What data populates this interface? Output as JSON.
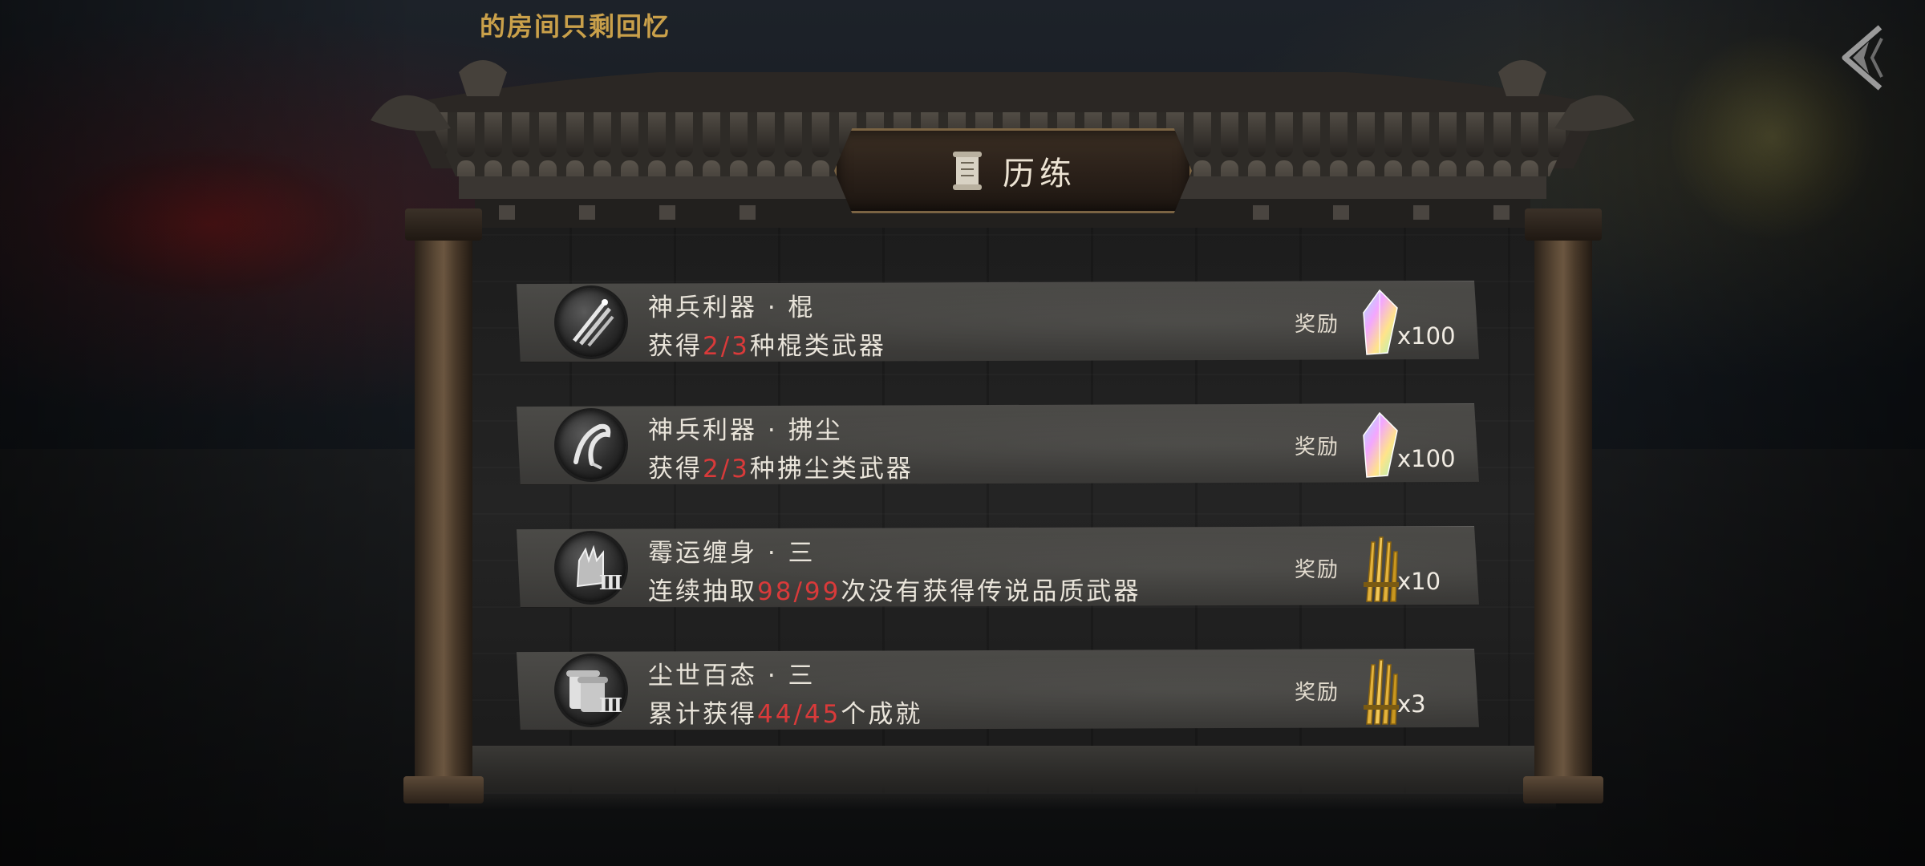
{
  "header": {
    "top_text": "‌\u0003的房间只剩回忆"
  },
  "panel": {
    "title": "历练",
    "title_icon": "scroll-icon"
  },
  "reward_label": "奖励",
  "rows": [
    {
      "name": "神兵利器 · 棍",
      "desc_pre": "获得",
      "desc_hl": "2/3",
      "desc_post": "种棍类武器",
      "icon": "staff-weapons-icon",
      "reward_icon": "crystal-icon",
      "reward_qty": "x100"
    },
    {
      "name": "神兵利器 · 拂尘",
      "desc_pre": "获得",
      "desc_hl": "2/3",
      "desc_post": "种拂尘类武器",
      "icon": "whisk-icon",
      "reward_icon": "crystal-icon",
      "reward_qty": "x100"
    },
    {
      "name": "霉运缠身 · 三",
      "desc_pre": "连续抽取",
      "desc_hl": "98/99",
      "desc_post": "次没有获得传说品质武器",
      "icon": "cursed-gauntlet-icon",
      "icon_roman": "Ⅲ",
      "reward_icon": "golden-incense-icon",
      "reward_qty": "x10"
    },
    {
      "name": "尘世百态 · 三",
      "desc_pre": "累计获得",
      "desc_hl": "44/45",
      "desc_post": "个成就",
      "icon": "scrolls-icon",
      "icon_roman": "Ⅲ",
      "reward_icon": "golden-incense-icon",
      "reward_qty": "x3"
    }
  ],
  "colors": {
    "highlight": "#d93a3a",
    "gold_text": "#c9a04a"
  }
}
